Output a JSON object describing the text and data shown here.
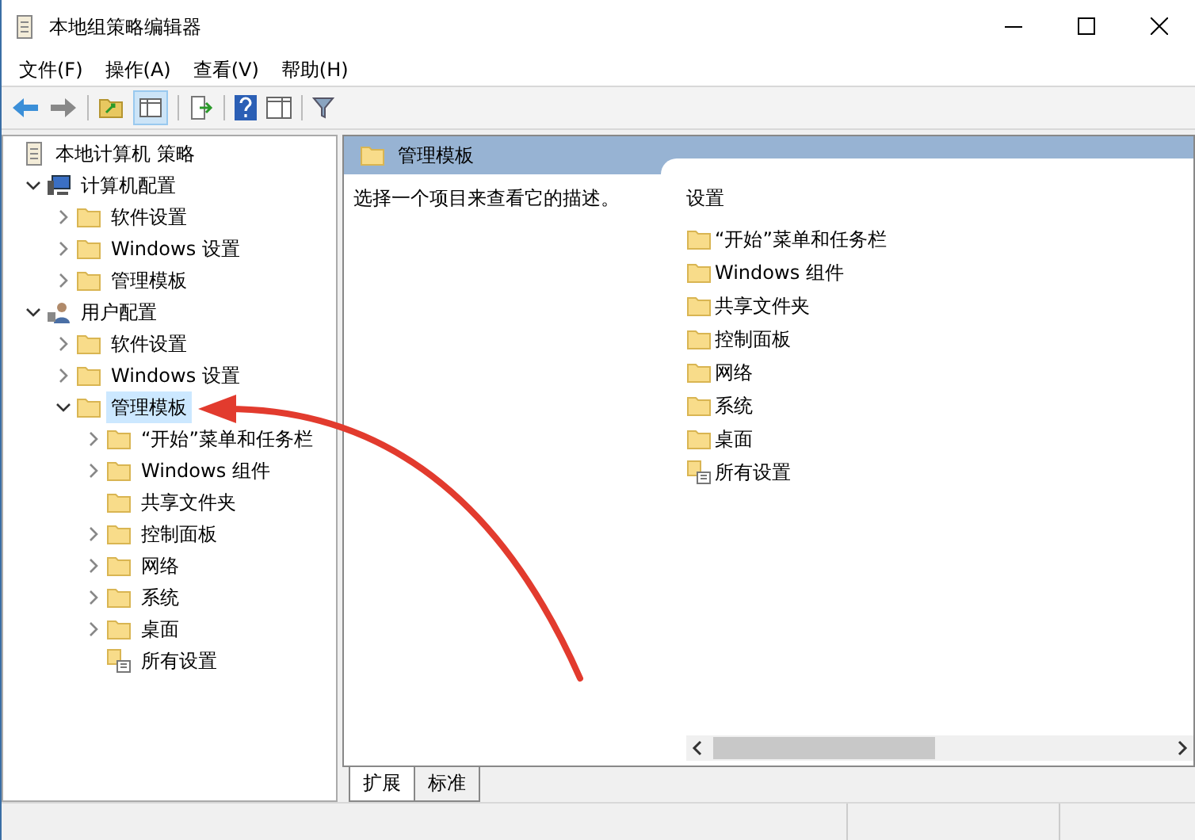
{
  "window": {
    "title": "本地组策略编辑器"
  },
  "menu": [
    {
      "label": "文件(F)"
    },
    {
      "label": "操作(A)"
    },
    {
      "label": "查看(V)"
    },
    {
      "label": "帮助(H)"
    }
  ],
  "tree": [
    {
      "label": "本地计算机 策略",
      "kind": "policy",
      "expandable": false,
      "selected": false,
      "children": [
        {
          "label": "计算机配置",
          "kind": "computer",
          "expandable": true,
          "expanded": true,
          "selected": false,
          "children": [
            {
              "label": "软件设置",
              "kind": "folder",
              "expandable": true,
              "expanded": false,
              "selected": false
            },
            {
              "label": "Windows 设置",
              "kind": "folder",
              "expandable": true,
              "expanded": false,
              "selected": false
            },
            {
              "label": "管理模板",
              "kind": "folder",
              "expandable": true,
              "expanded": false,
              "selected": false
            }
          ]
        },
        {
          "label": "用户配置",
          "kind": "user",
          "expandable": true,
          "expanded": true,
          "selected": false,
          "children": [
            {
              "label": "软件设置",
              "kind": "folder",
              "expandable": true,
              "expanded": false,
              "selected": false
            },
            {
              "label": "Windows 设置",
              "kind": "folder",
              "expandable": true,
              "expanded": false,
              "selected": false
            },
            {
              "label": "管理模板",
              "kind": "folder",
              "expandable": true,
              "expanded": true,
              "selected": true,
              "children": [
                {
                  "label": "“开始”菜单和任务栏",
                  "kind": "folder",
                  "expandable": true,
                  "expanded": false,
                  "selected": false
                },
                {
                  "label": "Windows 组件",
                  "kind": "folder",
                  "expandable": true,
                  "expanded": false,
                  "selected": false
                },
                {
                  "label": "共享文件夹",
                  "kind": "folder",
                  "expandable": false,
                  "selected": false
                },
                {
                  "label": "控制面板",
                  "kind": "folder",
                  "expandable": true,
                  "expanded": false,
                  "selected": false
                },
                {
                  "label": "网络",
                  "kind": "folder",
                  "expandable": true,
                  "expanded": false,
                  "selected": false
                },
                {
                  "label": "系统",
                  "kind": "folder",
                  "expandable": true,
                  "expanded": false,
                  "selected": false
                },
                {
                  "label": "桌面",
                  "kind": "folder",
                  "expandable": true,
                  "expanded": false,
                  "selected": false
                },
                {
                  "label": "所有设置",
                  "kind": "settings",
                  "expandable": false,
                  "selected": false
                }
              ]
            }
          ]
        }
      ]
    }
  ],
  "detail": {
    "header": "管理模板",
    "description": "选择一个项目来查看它的描述。",
    "list_heading": "设置",
    "items": [
      {
        "label": "“开始”菜单和任务栏",
        "kind": "folder"
      },
      {
        "label": "Windows 组件",
        "kind": "folder"
      },
      {
        "label": "共享文件夹",
        "kind": "folder"
      },
      {
        "label": "控制面板",
        "kind": "folder"
      },
      {
        "label": "网络",
        "kind": "folder"
      },
      {
        "label": "系统",
        "kind": "folder"
      },
      {
        "label": "桌面",
        "kind": "folder"
      },
      {
        "label": "所有设置",
        "kind": "settings"
      }
    ]
  },
  "tabs": [
    {
      "label": "扩展",
      "selected": true
    },
    {
      "label": "标准",
      "selected": false
    }
  ]
}
